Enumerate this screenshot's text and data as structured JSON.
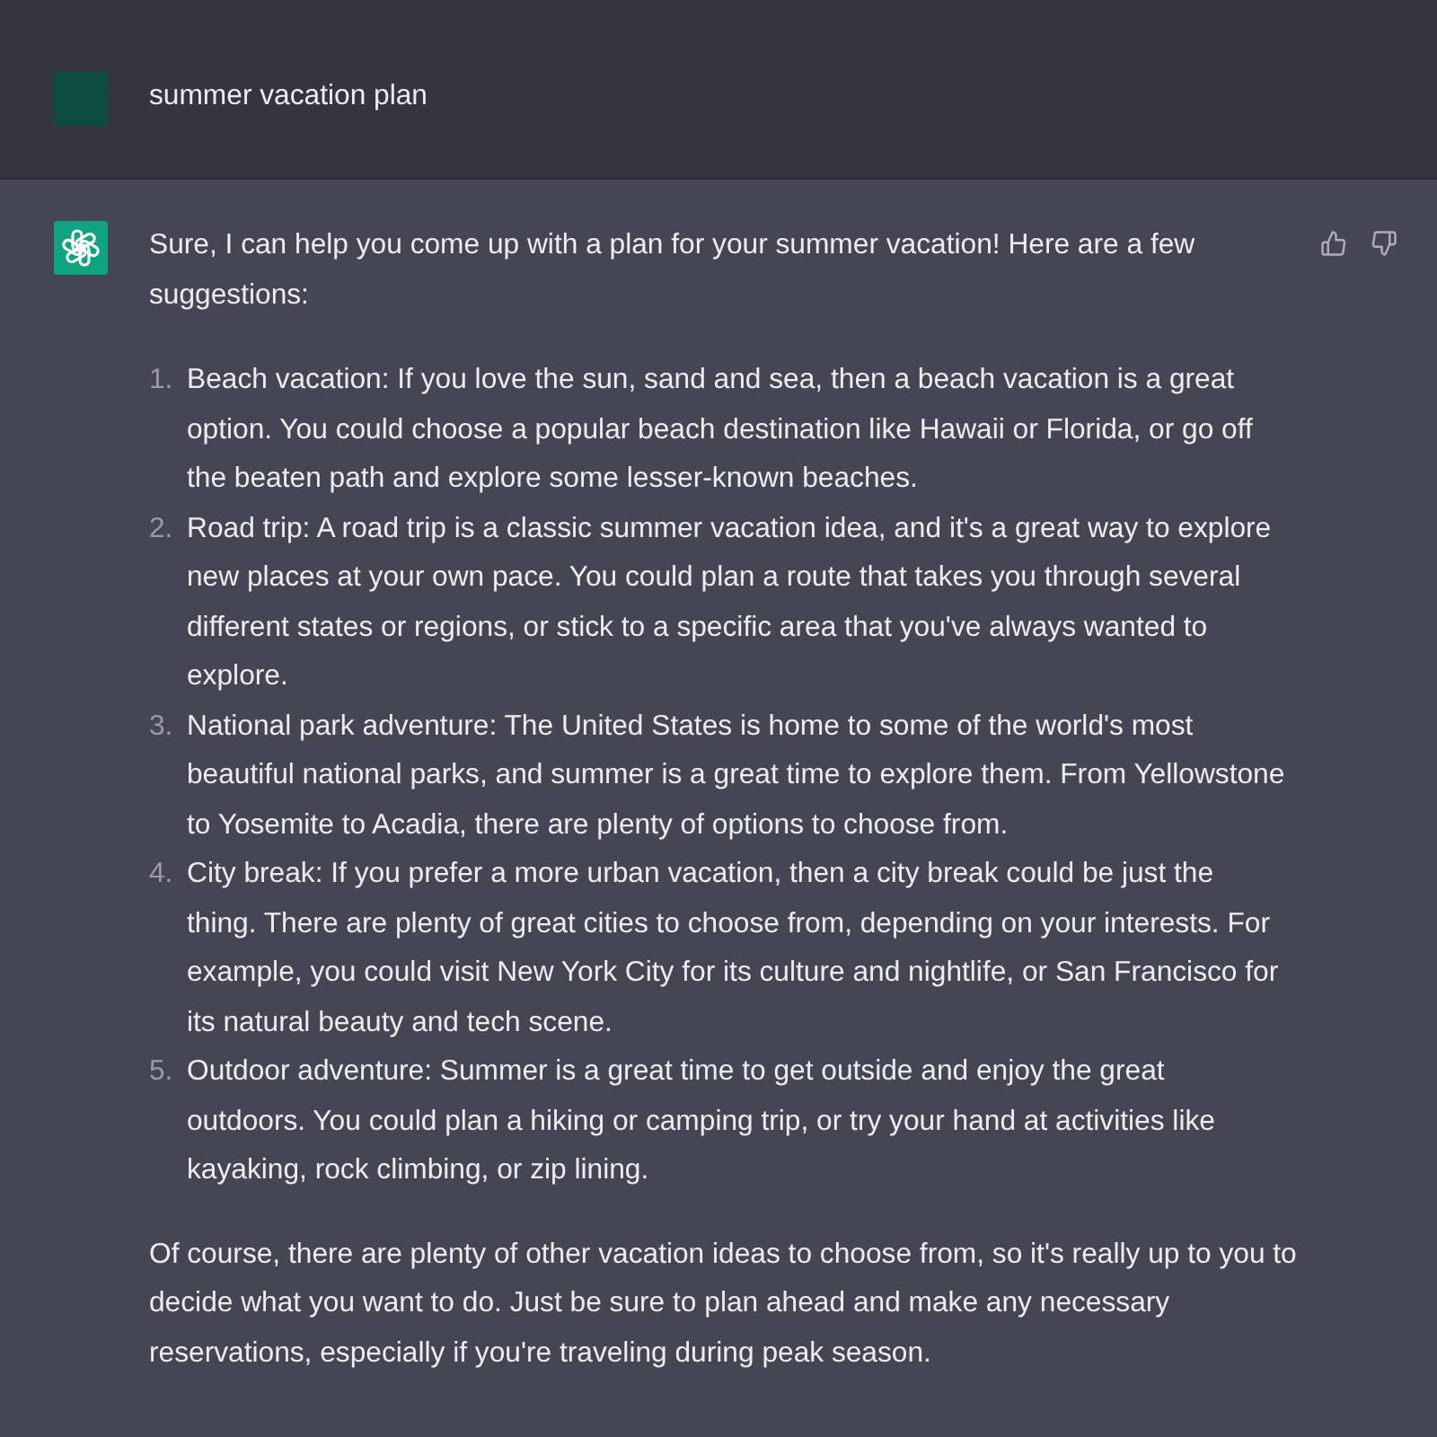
{
  "user_message": {
    "text": "summer vacation plan"
  },
  "assistant_message": {
    "intro": "Sure, I can help you come up with a plan for your summer vacation! Here are a few suggestions:",
    "items": [
      {
        "number": "1.",
        "text": "Beach vacation: If you love the sun, sand and sea, then a beach vacation is a great option. You could choose a popular beach destination like Hawaii or Florida, or go off the beaten path and explore some lesser-known beaches."
      },
      {
        "number": "2.",
        "text": "Road trip: A road trip is a classic summer vacation idea, and it's a great way to explore new places at your own pace. You could plan a route that takes you through several different states or regions, or stick to a specific area that you've always wanted to explore."
      },
      {
        "number": "3.",
        "text": "National park adventure: The United States is home to some of the world's most beautiful national parks, and summer is a great time to explore them. From Yellowstone to Yosemite to Acadia, there are plenty of options to choose from."
      },
      {
        "number": "4.",
        "text": "City break: If you prefer a more urban vacation, then a city break could be just the thing. There are plenty of great cities to choose from, depending on your interests. For example, you could visit New York City for its culture and nightlife, or San Francisco for its natural beauty and tech scene."
      },
      {
        "number": "5.",
        "text": "Outdoor adventure: Summer is a great time to get outside and enjoy the great outdoors. You could plan a hiking or camping trip, or try your hand at activities like kayaking, rock climbing, or zip lining."
      }
    ],
    "outro": "Of course, there are plenty of other vacation ideas to choose from, so it's really up to you to decide what you want to do. Just be sure to plan ahead and make any necessary reservations, especially if you're traveling during peak season."
  }
}
